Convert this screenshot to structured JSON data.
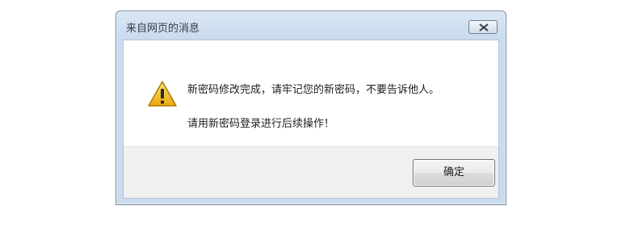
{
  "dialog": {
    "title": "来自网页的消息",
    "close_icon": "close-x-icon",
    "warning_icon": "warning-icon",
    "message_line1": "新密码修改完成，请牢记您的新密码，不要告诉他人。",
    "message_line2": "请用新密码登录进行后续操作！",
    "ok_label": "确定"
  },
  "colors": {
    "titlebar": "#cadbef",
    "warning_yellow": "#f2c21a",
    "footer": "#f0f0f0"
  }
}
